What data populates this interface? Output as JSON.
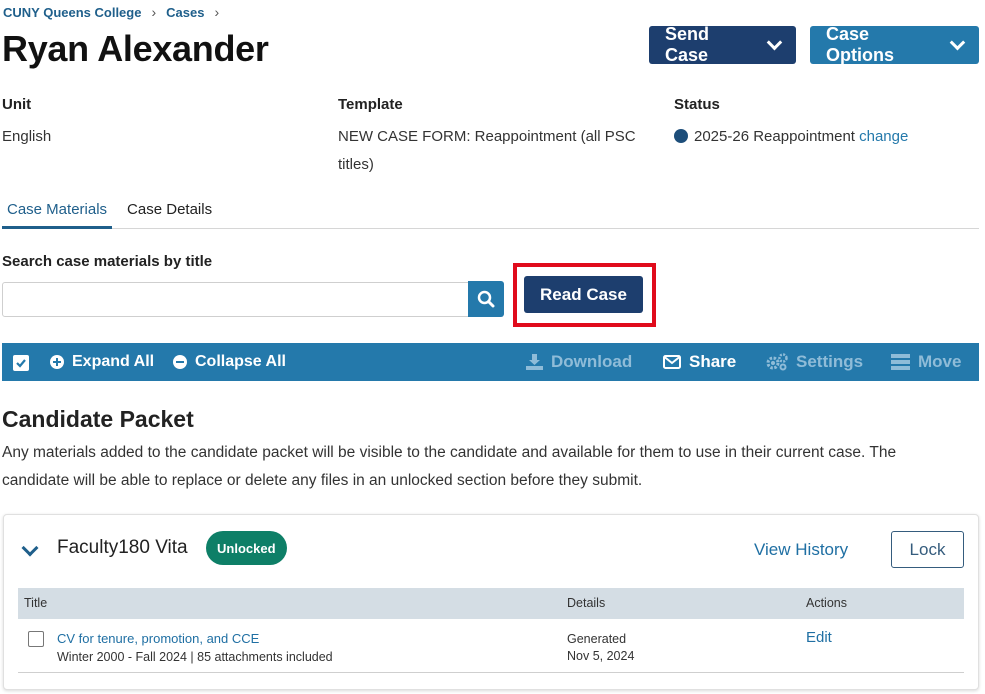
{
  "breadcrumb": {
    "items": [
      "CUNY Queens College",
      "Cases"
    ]
  },
  "page_title": "Ryan Alexander",
  "header_buttons": {
    "send_case": "Send Case",
    "case_options": "Case Options"
  },
  "meta": {
    "unit": {
      "label": "Unit",
      "value": "English"
    },
    "template": {
      "label": "Template",
      "value": "NEW CASE FORM: Reappointment (all PSC titles)"
    },
    "status": {
      "label": "Status",
      "value": "2025-26 Reappointment",
      "change_link": "change"
    }
  },
  "tabs": [
    {
      "label": "Case Materials"
    },
    {
      "label": "Case Details"
    }
  ],
  "search": {
    "label": "Search case materials by title",
    "value": "",
    "placeholder": ""
  },
  "read_case_button": "Read Case",
  "toolbar": {
    "expand_all": "Expand All",
    "collapse_all": "Collapse All",
    "download": "Download",
    "share": "Share",
    "settings": "Settings",
    "move": "Move"
  },
  "section": {
    "title": "Candidate Packet",
    "description": "Any materials added to the candidate packet will be visible to the candidate and available for them to use in their current case. The candidate will be able to replace or delete any files in an unlocked section before they submit."
  },
  "card": {
    "title": "Faculty180 Vita",
    "badge": "Unlocked",
    "view_history": "View History",
    "lock": "Lock",
    "columns": [
      "Title",
      "Details",
      "Actions"
    ],
    "rows": [
      {
        "title": "CV for tenure, promotion, and CCE",
        "subtitle": "Winter 2000 - Fall 2024 | 85 attachments included",
        "details_line1": "Generated",
        "details_line2": "Nov 5, 2024",
        "action": "Edit"
      }
    ]
  },
  "colors": {
    "navy": "#1d3e6e",
    "blue": "#2479ab",
    "link": "#1f6fa3",
    "badge_green": "#0e7f67",
    "highlight_red": "#e00b1c"
  }
}
